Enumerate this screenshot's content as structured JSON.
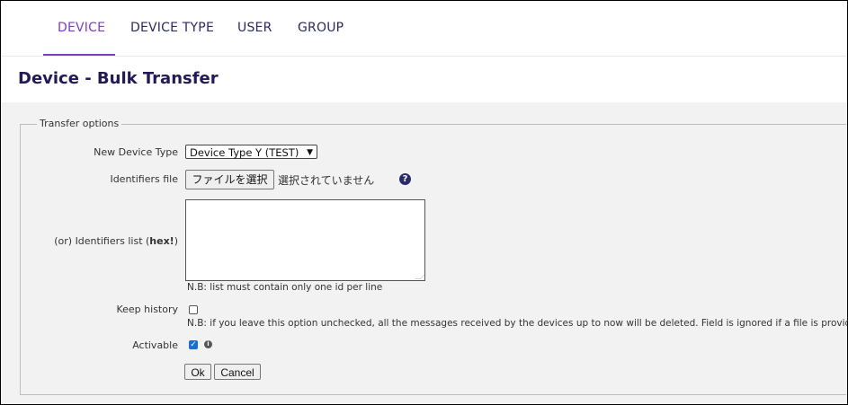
{
  "nav": {
    "tabs": [
      {
        "label": "DEVICE",
        "active": true
      },
      {
        "label": "DEVICE TYPE",
        "active": false
      },
      {
        "label": "USER",
        "active": false
      },
      {
        "label": "GROUP",
        "active": false
      }
    ]
  },
  "page": {
    "title": "Device - Bulk Transfer"
  },
  "form": {
    "legend": "Transfer options",
    "new_device_type": {
      "label": "New Device Type",
      "selected": "Device Type Y (TEST)"
    },
    "identifiers_file": {
      "label": "Identifiers file",
      "button": "ファイルを選択",
      "status": "選択されていません"
    },
    "identifiers_list": {
      "label_prefix": "(or) Identifiers list (",
      "label_bold": "hex!",
      "label_suffix": ")",
      "value": "",
      "note": "N.B: list must contain only one id per line"
    },
    "keep_history": {
      "label": "Keep history",
      "checked": false,
      "note": "N.B: if you leave this option unchecked, all the messages received by the devices up to now will be deleted. Field is ignored if a file is provided."
    },
    "activable": {
      "label": "Activable",
      "checked": true
    },
    "ok_label": "Ok",
    "cancel_label": "Cancel"
  },
  "colors": {
    "accent": "#7b3fc4",
    "nav_text": "#2b2b5e",
    "title": "#231a55",
    "checkbox_checked": "#1a6fd4"
  },
  "icons": {
    "help": "question-circle-icon",
    "info": "info-circle-icon",
    "select_caret": "chevron-down-icon"
  }
}
